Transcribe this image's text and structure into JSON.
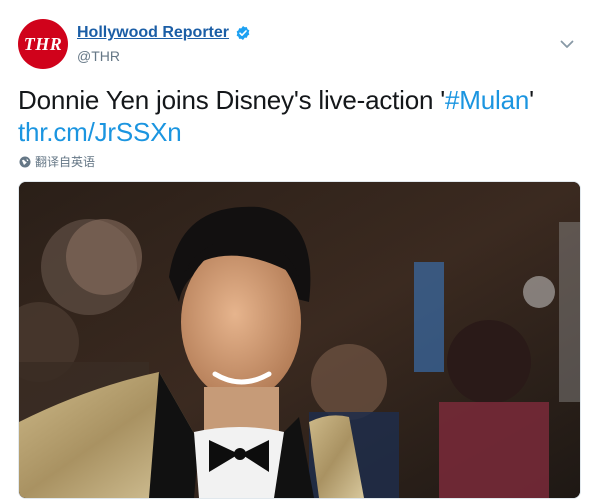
{
  "tweet": {
    "avatar_text": "THR",
    "author_name": "Hollywood Reporter",
    "author_handle": "@THR",
    "text_main": "Donnie Yen joins Disney's live-action '",
    "hashtag": "#Mulan",
    "text_end": "'",
    "link": "thr.cm/JrSSXn",
    "translate_label": "翻译自英语"
  },
  "icons": {
    "verified": "verified-badge-icon",
    "caret": "chevron-down-icon",
    "globe": "globe-icon"
  },
  "colors": {
    "brand_red": "#d0021b",
    "link_blue": "#1b95e0",
    "name_blue": "#1b5ea6",
    "secondary": "#657786"
  }
}
